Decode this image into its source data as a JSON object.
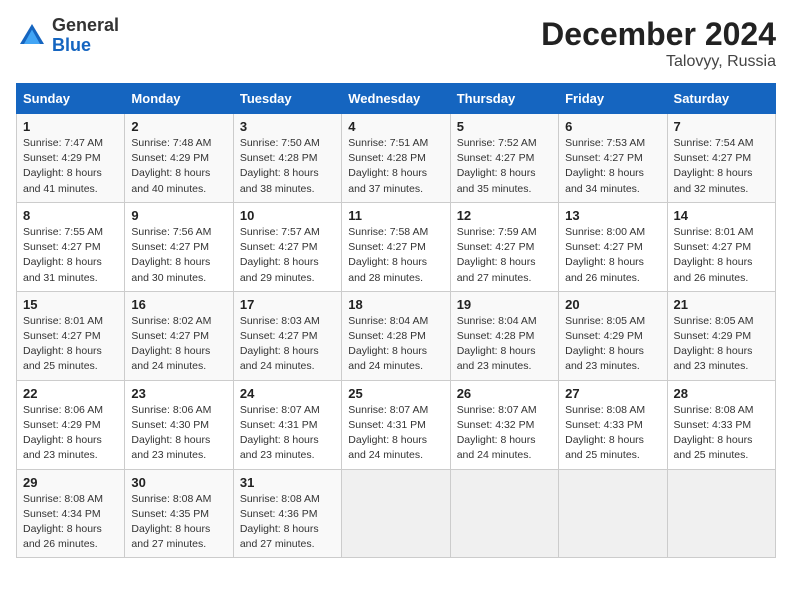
{
  "header": {
    "logo_line1": "General",
    "logo_line2": "Blue",
    "month_year": "December 2024",
    "location": "Talovyy, Russia"
  },
  "days_of_week": [
    "Sunday",
    "Monday",
    "Tuesday",
    "Wednesday",
    "Thursday",
    "Friday",
    "Saturday"
  ],
  "weeks": [
    [
      {
        "day": 1,
        "sunrise": "7:47 AM",
        "sunset": "4:29 PM",
        "daylight": "8 hours and 41 minutes."
      },
      {
        "day": 2,
        "sunrise": "7:48 AM",
        "sunset": "4:29 PM",
        "daylight": "8 hours and 40 minutes."
      },
      {
        "day": 3,
        "sunrise": "7:50 AM",
        "sunset": "4:28 PM",
        "daylight": "8 hours and 38 minutes."
      },
      {
        "day": 4,
        "sunrise": "7:51 AM",
        "sunset": "4:28 PM",
        "daylight": "8 hours and 37 minutes."
      },
      {
        "day": 5,
        "sunrise": "7:52 AM",
        "sunset": "4:27 PM",
        "daylight": "8 hours and 35 minutes."
      },
      {
        "day": 6,
        "sunrise": "7:53 AM",
        "sunset": "4:27 PM",
        "daylight": "8 hours and 34 minutes."
      },
      {
        "day": 7,
        "sunrise": "7:54 AM",
        "sunset": "4:27 PM",
        "daylight": "8 hours and 32 minutes."
      }
    ],
    [
      {
        "day": 8,
        "sunrise": "7:55 AM",
        "sunset": "4:27 PM",
        "daylight": "8 hours and 31 minutes."
      },
      {
        "day": 9,
        "sunrise": "7:56 AM",
        "sunset": "4:27 PM",
        "daylight": "8 hours and 30 minutes."
      },
      {
        "day": 10,
        "sunrise": "7:57 AM",
        "sunset": "4:27 PM",
        "daylight": "8 hours and 29 minutes."
      },
      {
        "day": 11,
        "sunrise": "7:58 AM",
        "sunset": "4:27 PM",
        "daylight": "8 hours and 28 minutes."
      },
      {
        "day": 12,
        "sunrise": "7:59 AM",
        "sunset": "4:27 PM",
        "daylight": "8 hours and 27 minutes."
      },
      {
        "day": 13,
        "sunrise": "8:00 AM",
        "sunset": "4:27 PM",
        "daylight": "8 hours and 26 minutes."
      },
      {
        "day": 14,
        "sunrise": "8:01 AM",
        "sunset": "4:27 PM",
        "daylight": "8 hours and 26 minutes."
      }
    ],
    [
      {
        "day": 15,
        "sunrise": "8:01 AM",
        "sunset": "4:27 PM",
        "daylight": "8 hours and 25 minutes."
      },
      {
        "day": 16,
        "sunrise": "8:02 AM",
        "sunset": "4:27 PM",
        "daylight": "8 hours and 24 minutes."
      },
      {
        "day": 17,
        "sunrise": "8:03 AM",
        "sunset": "4:27 PM",
        "daylight": "8 hours and 24 minutes."
      },
      {
        "day": 18,
        "sunrise": "8:04 AM",
        "sunset": "4:28 PM",
        "daylight": "8 hours and 24 minutes."
      },
      {
        "day": 19,
        "sunrise": "8:04 AM",
        "sunset": "4:28 PM",
        "daylight": "8 hours and 23 minutes."
      },
      {
        "day": 20,
        "sunrise": "8:05 AM",
        "sunset": "4:29 PM",
        "daylight": "8 hours and 23 minutes."
      },
      {
        "day": 21,
        "sunrise": "8:05 AM",
        "sunset": "4:29 PM",
        "daylight": "8 hours and 23 minutes."
      }
    ],
    [
      {
        "day": 22,
        "sunrise": "8:06 AM",
        "sunset": "4:29 PM",
        "daylight": "8 hours and 23 minutes."
      },
      {
        "day": 23,
        "sunrise": "8:06 AM",
        "sunset": "4:30 PM",
        "daylight": "8 hours and 23 minutes."
      },
      {
        "day": 24,
        "sunrise": "8:07 AM",
        "sunset": "4:31 PM",
        "daylight": "8 hours and 23 minutes."
      },
      {
        "day": 25,
        "sunrise": "8:07 AM",
        "sunset": "4:31 PM",
        "daylight": "8 hours and 24 minutes."
      },
      {
        "day": 26,
        "sunrise": "8:07 AM",
        "sunset": "4:32 PM",
        "daylight": "8 hours and 24 minutes."
      },
      {
        "day": 27,
        "sunrise": "8:08 AM",
        "sunset": "4:33 PM",
        "daylight": "8 hours and 25 minutes."
      },
      {
        "day": 28,
        "sunrise": "8:08 AM",
        "sunset": "4:33 PM",
        "daylight": "8 hours and 25 minutes."
      }
    ],
    [
      {
        "day": 29,
        "sunrise": "8:08 AM",
        "sunset": "4:34 PM",
        "daylight": "8 hours and 26 minutes."
      },
      {
        "day": 30,
        "sunrise": "8:08 AM",
        "sunset": "4:35 PM",
        "daylight": "8 hours and 27 minutes."
      },
      {
        "day": 31,
        "sunrise": "8:08 AM",
        "sunset": "4:36 PM",
        "daylight": "8 hours and 27 minutes."
      },
      null,
      null,
      null,
      null
    ]
  ]
}
